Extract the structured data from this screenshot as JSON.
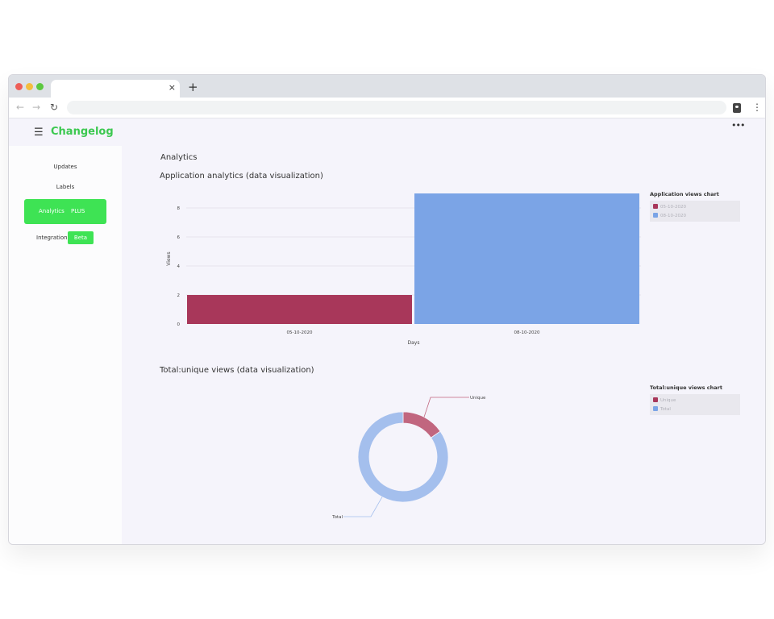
{
  "browser": {
    "close_tab": "×",
    "new_tab": "+"
  },
  "header": {
    "brand": "Changelog",
    "more": "•••"
  },
  "sidebar": {
    "items": [
      {
        "label": "Updates"
      },
      {
        "label": "Labels"
      },
      {
        "label": "Analytics",
        "badge": "PLUS",
        "active": true
      },
      {
        "label": "Integration",
        "badge": "Beta"
      }
    ]
  },
  "main": {
    "title": "Analytics",
    "section1_title": "Application analytics (data visualization)",
    "section2_title": "Total:unique views (data visualization)"
  },
  "colors": {
    "accent": "#3ee354",
    "brand": "#3cc850",
    "series_a": "#a8375a",
    "series_b": "#7ba4e6"
  },
  "chart_data": [
    {
      "type": "bar",
      "title": "Application views chart",
      "categories": [
        "05-10-2020",
        "08-10-2020"
      ],
      "values": [
        2,
        9
      ],
      "colors": [
        "#a8375a",
        "#7ba4e6"
      ],
      "xlabel": "Days",
      "ylabel": "Views",
      "yticks": [
        0,
        2,
        4,
        6,
        8
      ],
      "ylim": [
        0,
        9
      ],
      "legend": [
        "05-10-2020",
        "08-10-2020"
      ],
      "legend_position": "top-right",
      "grid": true
    },
    {
      "type": "pie",
      "title": "Total:unique views chart",
      "labels": [
        "Unique",
        "Total"
      ],
      "values": [
        2,
        11
      ],
      "colors": [
        "#c1667f",
        "#a4bfed"
      ],
      "donut": true,
      "legend": [
        "Unique",
        "Total"
      ],
      "legend_position": "top-right"
    }
  ]
}
